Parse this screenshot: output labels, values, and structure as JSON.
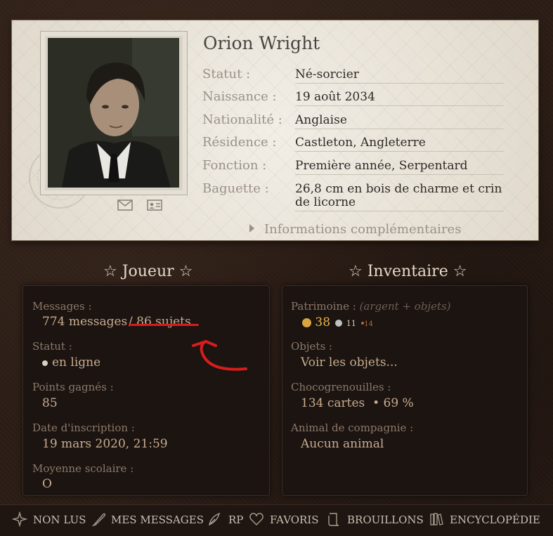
{
  "profile": {
    "name": "Orion Wright",
    "fields": [
      {
        "label": "Statut :",
        "value": "Né-sorcier"
      },
      {
        "label": "Naissance :",
        "value": "19 août 2034"
      },
      {
        "label": "Nationalité :",
        "value": "Anglaise"
      },
      {
        "label": "Résidence :",
        "value": "Castleton, Angleterre"
      },
      {
        "label": "Fonction :",
        "value": "Première année, Serpentard"
      },
      {
        "label": "Baguette :",
        "value": "26,8 cm en bois de charme et crin de licorne"
      }
    ],
    "more_info": "Informations complémentaires"
  },
  "player": {
    "title": "☆ Joueur ☆",
    "messages_label": "Messages :",
    "messages_value": "774 messages",
    "topics_value": "/ 86 sujets",
    "status_label": "Statut :",
    "status_value": "en ligne",
    "points_label": "Points gagnés :",
    "points_value": "85",
    "registration_label": "Date d'inscription :",
    "registration_value": "19 mars 2020, 21:59",
    "average_label": "Moyenne scolaire :",
    "average_value": "O"
  },
  "inventory": {
    "title": "☆ Inventaire ☆",
    "wealth_label": "Patrimoine :",
    "wealth_note": "(argent + objets)",
    "gold": "38",
    "silver": "11",
    "bronze": "14",
    "objects_label": "Objets :",
    "objects_value": "Voir les objets...",
    "cards_label": "Chocogrenouilles :",
    "cards_value": "134 cartes",
    "cards_separator": "•",
    "cards_percent": "69 %",
    "pet_label": "Animal de compagnie :",
    "pet_value": "Aucun animal"
  },
  "nav": {
    "unread": "NON LUS",
    "my_messages": "MES MESSAGES",
    "rp": "RP",
    "favorites": "FAVORIS",
    "drafts": "BROUILLONS",
    "encyclopedia": "ENCYCLOPÉDIE"
  },
  "icons": {
    "mail": "envelope-icon",
    "profile": "id-card-icon",
    "unread": "sparkle-icon",
    "messages": "quill-icon",
    "rp": "feather-icon",
    "favorites": "heart-icon",
    "drafts": "scroll-icon",
    "encyclopedia": "books-icon"
  },
  "colors": {
    "gold": "#d9a640",
    "silver": "#c0c0c0",
    "bronze": "#b5683a",
    "online": "#d8d0c4",
    "annotation": "#d61d1d"
  }
}
